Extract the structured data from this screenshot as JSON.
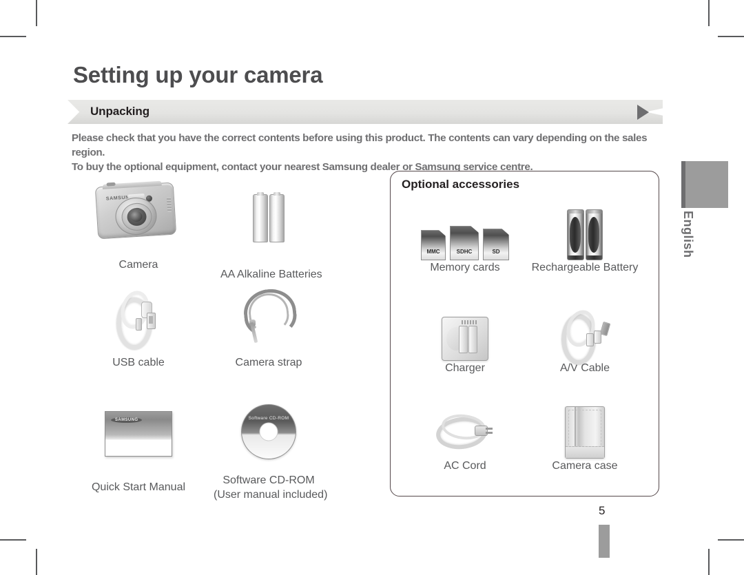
{
  "page": {
    "title": "Setting up your camera",
    "section_label": "Unpacking",
    "intro_line1": "Please check that you have the correct contents before using this product. The contents can vary depending on the sales region.",
    "intro_line2": "To buy the optional equipment, contact your nearest Samsung dealer or Samsung service centre.",
    "page_number": "5",
    "language_tab": "English",
    "accent_color": "#9c9c9c",
    "title_color": "#4d4d4f",
    "box_border_color": "#54474a"
  },
  "included_items": [
    {
      "caption": "Camera",
      "caption2": "",
      "icon": "camera-icon"
    },
    {
      "caption": "AA Alkaline Batteries",
      "caption2": "",
      "icon": "aa-batteries-icon"
    },
    {
      "caption": "USB cable",
      "caption2": "",
      "icon": "usb-cable-icon"
    },
    {
      "caption": "Camera strap",
      "caption2": "",
      "icon": "camera-strap-icon"
    },
    {
      "caption": "Quick Start Manual",
      "caption2": "",
      "icon": "manual-icon"
    },
    {
      "caption": "Software CD-ROM",
      "caption2": "(User manual included)",
      "icon": "cd-rom-icon"
    }
  ],
  "optional_box": {
    "title": "Optional accessories",
    "items": [
      {
        "caption": "Memory cards",
        "icon": "memory-cards-icon"
      },
      {
        "caption": "Rechargeable Battery",
        "icon": "rechargeable-battery-icon"
      },
      {
        "caption": "Charger",
        "icon": "charger-icon"
      },
      {
        "caption": "A/V Cable",
        "icon": "av-cable-icon"
      },
      {
        "caption": "AC Cord",
        "icon": "ac-cord-icon"
      },
      {
        "caption": "Camera case",
        "icon": "camera-case-icon"
      }
    ],
    "memory_cards": [
      {
        "label": "MMC"
      },
      {
        "label": "SDHC"
      },
      {
        "label": "SD"
      }
    ]
  },
  "illustration_text": {
    "camera_brand": "SAMSUNG",
    "manual_brand": "SAMSUNG",
    "cd_label": "Software CD-ROM"
  }
}
